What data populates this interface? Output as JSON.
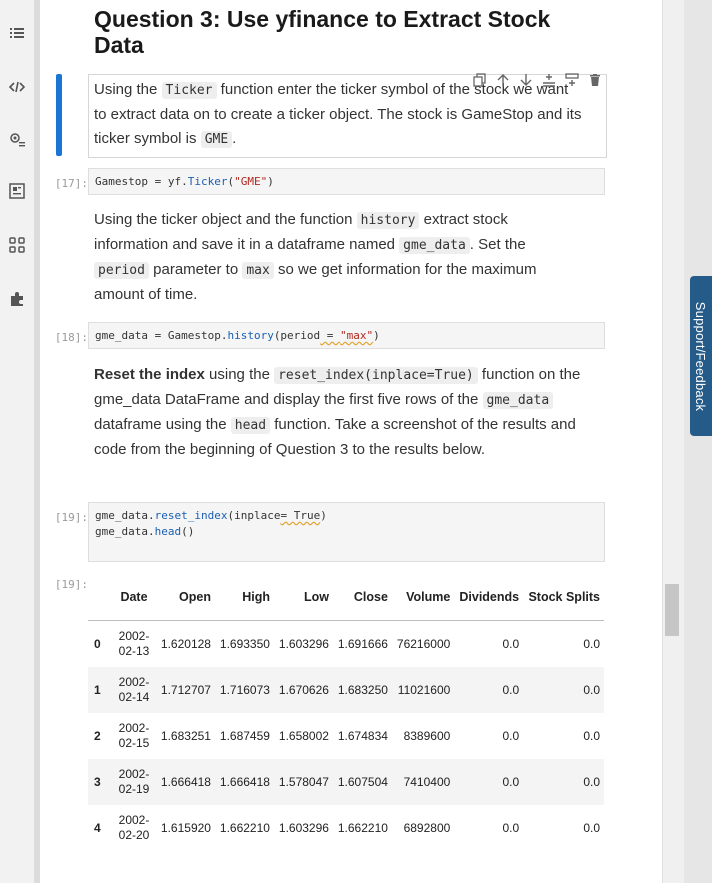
{
  "sidebar": {
    "icons": [
      "list-icon",
      "code-icon",
      "gear-list-icon",
      "dashboard-icon",
      "extension-blocks-icon",
      "puzzle-icon"
    ]
  },
  "title": "Question 3: Use yfinance to Extract Stock Data",
  "md1": {
    "t1": "Using the ",
    "c1": "Ticker",
    "t2": " function enter the ticker symbol of the stock we want to extract data on to create a ticker object. The stock is GameStop and its ticker symbol is ",
    "c2": "GME",
    "t3": "."
  },
  "cell17": {
    "prompt": "[17]:",
    "a": "Gamestop = yf.",
    "b": "Ticker",
    "c": "(",
    "d": "\"GME\"",
    "e": ")"
  },
  "md2": {
    "t1": "Using the ticker object and the function ",
    "c1": "history",
    "t2": " extract stock information and save it in a dataframe named ",
    "c2": "gme_data",
    "t3": ". Set the ",
    "c3": "period",
    "t4": " parameter to ",
    "c4": "max",
    "t5": " so we get information for the maximum amount of time."
  },
  "cell18": {
    "prompt": "[18]:",
    "a": "gme_data = Gamestop.",
    "b": "history",
    "c": "(period",
    "d": " = ",
    "e": "\"max\"",
    "f": ")"
  },
  "md3": {
    "b1": "Reset the index",
    "t1": " using the ",
    "c1": "reset_index(inplace=True)",
    "t2": " function on the gme_data DataFrame and display the first five rows of the ",
    "c2": "gme_data",
    "t3": " dataframe using the ",
    "c3": "head",
    "t4": " function. Take a screenshot of the results and code from the beginning of Question 3 to the results below."
  },
  "cell19": {
    "prompt": "[19]:",
    "l1a": "gme_data.",
    "l1b": "reset_index",
    "l1c": "(inplace",
    "l1d": "= True",
    "l1e": ")",
    "l2a": "gme_data.",
    "l2b": "head",
    "l2c": "()"
  },
  "output19": {
    "prompt": "[19]:",
    "headers": [
      "",
      "Date",
      "Open",
      "High",
      "Low",
      "Close",
      "Volume",
      "Dividends",
      "Stock Splits"
    ],
    "rows": [
      [
        "0",
        "2002-02-13",
        "1.620128",
        "1.693350",
        "1.603296",
        "1.691666",
        "76216000",
        "0.0",
        "0.0"
      ],
      [
        "1",
        "2002-02-14",
        "1.712707",
        "1.716073",
        "1.670626",
        "1.683250",
        "11021600",
        "0.0",
        "0.0"
      ],
      [
        "2",
        "2002-02-15",
        "1.683251",
        "1.687459",
        "1.658002",
        "1.674834",
        "8389600",
        "0.0",
        "0.0"
      ],
      [
        "3",
        "2002-02-19",
        "1.666418",
        "1.666418",
        "1.578047",
        "1.607504",
        "7410400",
        "0.0",
        "0.0"
      ],
      [
        "4",
        "2002-02-20",
        "1.615920",
        "1.662210",
        "1.603296",
        "1.662210",
        "6892800",
        "0.0",
        "0.0"
      ]
    ]
  },
  "feedback": "Support/Feedback"
}
